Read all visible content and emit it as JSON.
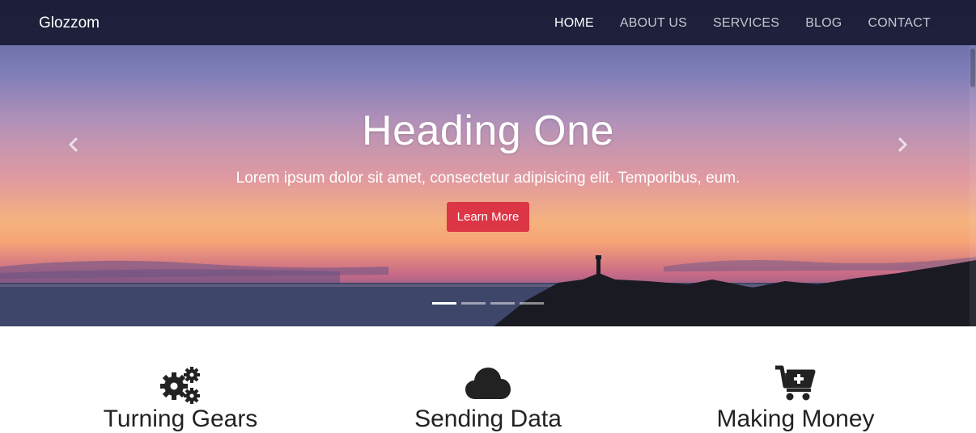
{
  "navbar": {
    "brand": "Glozzom",
    "items": [
      {
        "label": "HOME",
        "active": true
      },
      {
        "label": "ABOUT US",
        "active": false
      },
      {
        "label": "SERVICES",
        "active": false
      },
      {
        "label": "BLOG",
        "active": false
      },
      {
        "label": "CONTACT",
        "active": false
      }
    ]
  },
  "hero": {
    "heading": "Heading One",
    "text": "Lorem ipsum dolor sit amet, consectetur adipisicing elit. Temporibus, eum.",
    "button_label": "Learn More",
    "slide_count": 4,
    "active_slide": 1
  },
  "features": [
    {
      "title": "Turning Gears",
      "icon": "gears-icon"
    },
    {
      "title": "Sending Data",
      "icon": "cloud-icon"
    },
    {
      "title": "Making Money",
      "icon": "cart-plus-icon"
    }
  ],
  "colors": {
    "accent": "#dc3545",
    "navbar_bg": "#14162c",
    "icon": "#222222"
  }
}
